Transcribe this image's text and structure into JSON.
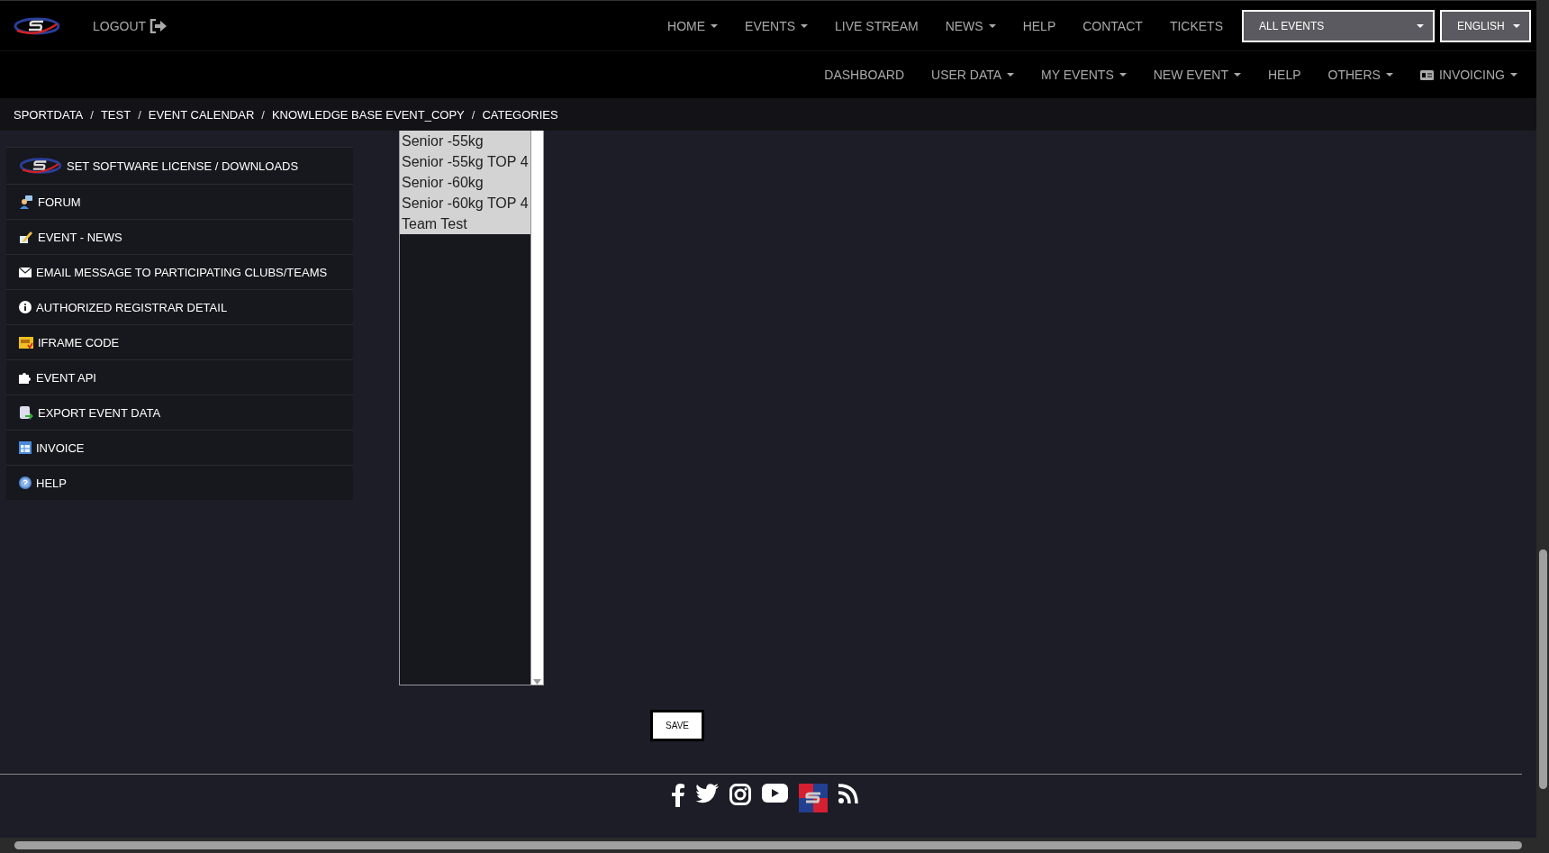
{
  "top_nav": {
    "logout": "LOGOUT",
    "items": [
      {
        "label": "HOME",
        "dropdown": true
      },
      {
        "label": "EVENTS",
        "dropdown": true
      },
      {
        "label": "LIVE STREAM",
        "dropdown": false
      },
      {
        "label": "NEWS",
        "dropdown": true
      },
      {
        "label": "HELP",
        "dropdown": false
      },
      {
        "label": "CONTACT",
        "dropdown": false
      },
      {
        "label": "TICKETS",
        "dropdown": false
      }
    ],
    "event_select": "ALL EVENTS",
    "language_select": "ENGLISH"
  },
  "sub_nav": [
    {
      "label": "DASHBOARD",
      "dropdown": false
    },
    {
      "label": "USER DATA",
      "dropdown": true
    },
    {
      "label": "MY EVENTS",
      "dropdown": true
    },
    {
      "label": "NEW EVENT",
      "dropdown": true
    },
    {
      "label": "HELP",
      "dropdown": false
    },
    {
      "label": "OTHERS",
      "dropdown": true
    },
    {
      "label": "INVOICING",
      "dropdown": true,
      "kind": "icon"
    }
  ],
  "breadcrumb": [
    {
      "label": "SPORTDATA",
      "separator": "/"
    },
    {
      "label": "TEST",
      "separator": "/"
    },
    {
      "label": "EVENT CALENDAR",
      "separator": "/"
    },
    {
      "label": "KNOWLEDGE BASE EVENT_COPY",
      "separator": "/"
    },
    {
      "label": "CATEGORIES"
    }
  ],
  "sidebar": {
    "items": [
      "SET SOFTWARE LICENSE / DOWNLOADS",
      "FORUM",
      "EVENT - NEWS",
      "EMAIL MESSAGE TO PARTICIPATING CLUBS/TEAMS",
      "AUTHORIZED REGISTRAR DETAIL",
      "IFRAME CODE",
      "EVENT API",
      "EXPORT EVENT DATA",
      "INVOICE",
      "HELP"
    ]
  },
  "category_list": [
    {
      "label": "Senior -55kg",
      "selected": true
    },
    {
      "label": "Senior -55kg TOP 4",
      "selected": true
    },
    {
      "label": "Senior -60kg",
      "selected": true
    },
    {
      "label": "Senior -60kg TOP 4",
      "selected": true
    },
    {
      "label": "Team Test",
      "selected": true
    }
  ],
  "save_button": "SAVE"
}
